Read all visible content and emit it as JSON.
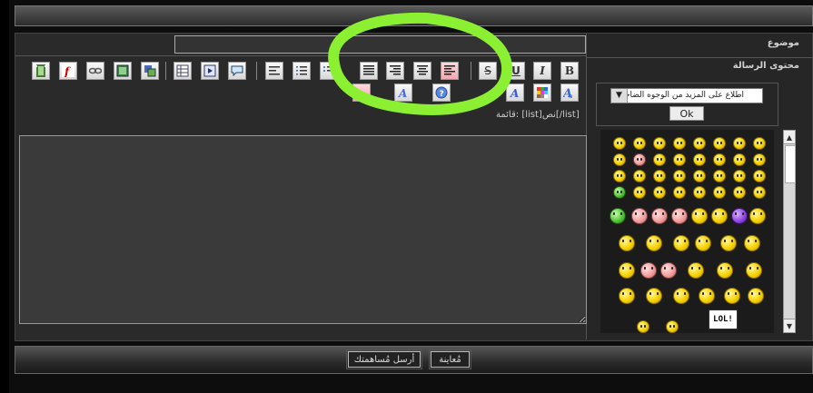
{
  "labels": {
    "subject": "موضوع",
    "message": "محتوى الرسالة",
    "list_hint": "قائمة: [list]نص[/list]"
  },
  "subject_field": {
    "value": ""
  },
  "editor": {
    "value": ""
  },
  "smilies": {
    "select_value": "اطلاع على المزيد من الوجوه الضاحكة",
    "ok_label": "Ok",
    "lol_text": "LOL!"
  },
  "buttons": {
    "preview": "مُعاينة",
    "send": "أرسل مُساهمتك"
  },
  "toolbar": {
    "row1": [
      "film-icon",
      "flash-icon",
      "link-icon",
      "image-icon",
      "gallery-icon",
      "table-icon",
      "media-icon",
      "speech-bubble-icon",
      "align-left-icon",
      "ordered-list-icon",
      "unordered-list-icon",
      "align-justify-icon",
      "align-right-icon",
      "align-center-icon",
      "align-left-pink-icon",
      "strikethrough-icon",
      "underline-icon",
      "italic-icon",
      "bold-icon"
    ],
    "row2": [
      "font-size-icon",
      "font-face-icon",
      "help-icon",
      "text-color-icon",
      "color-grid-icon",
      "text-style-icon"
    ],
    "bold": "B",
    "italic": "I",
    "underline": "U",
    "strike": "S"
  },
  "highlight": {
    "color": "#8cf032"
  }
}
